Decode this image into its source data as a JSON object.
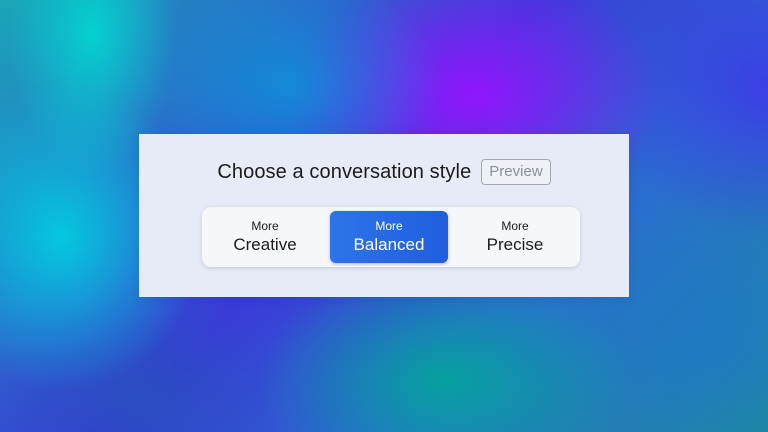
{
  "dialog": {
    "title": "Choose a conversation style",
    "badge": "Preview"
  },
  "styles": {
    "selected": "balanced",
    "options": [
      {
        "prefix": "More",
        "label": "Creative"
      },
      {
        "prefix": "More",
        "label": "Balanced"
      },
      {
        "prefix": "More",
        "label": "Precise"
      }
    ]
  },
  "colors": {
    "accent": "#2267e3",
    "panel": "#e7ebf7"
  }
}
